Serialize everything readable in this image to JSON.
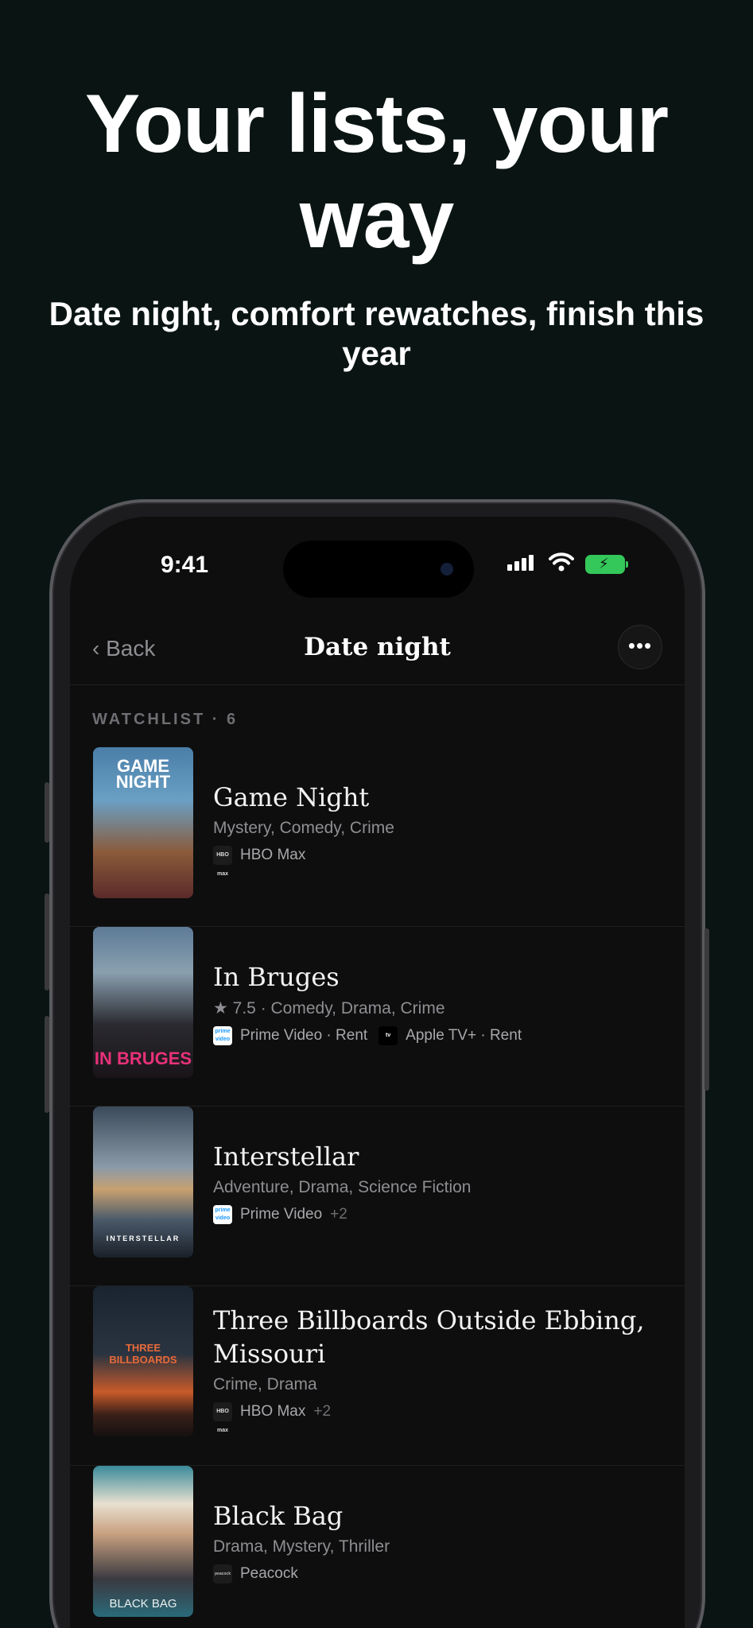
{
  "hero": {
    "headline": "Your lists, your way",
    "subheadline": "Date night, comfort rewatches, finish this year"
  },
  "status_bar": {
    "time": "9:41"
  },
  "nav": {
    "back_label": "‹ Back",
    "title": "Date night",
    "more_label": "•••"
  },
  "section": {
    "label": "WATCHLIST · 6"
  },
  "movies": [
    {
      "title": "Game Night",
      "meta": "Mystery, Comedy, Crime",
      "poster_text": "GAME NIGHT",
      "providers": [
        {
          "logo": "HBO max",
          "name": "HBO Max"
        }
      ],
      "more": ""
    },
    {
      "title": "In Bruges",
      "meta": "★ 7.5 · Comedy, Drama, Crime",
      "poster_text": "IN BRUGES",
      "providers": [
        {
          "logo": "prime video",
          "name": "Prime Video · Rent"
        },
        {
          "logo": "tv",
          "name": "Apple TV+ · Rent"
        }
      ],
      "more": ""
    },
    {
      "title": "Interstellar",
      "meta": "Adventure, Drama, Science Fiction",
      "poster_text": "INTERSTELLAR",
      "providers": [
        {
          "logo": "prime video",
          "name": "Prime Video"
        }
      ],
      "more": "+2"
    },
    {
      "title": "Three Billboards Outside Ebbing, Missouri",
      "meta": "Crime, Drama",
      "poster_text": "THREE BILLBOARDS",
      "providers": [
        {
          "logo": "HBO max",
          "name": "HBO Max"
        }
      ],
      "more": "+2"
    },
    {
      "title": "Black Bag",
      "meta": "Drama, Mystery, Thriller",
      "poster_text": "BLACK BAG",
      "providers": [
        {
          "logo": "peacock",
          "name": "Peacock"
        }
      ],
      "more": ""
    }
  ]
}
